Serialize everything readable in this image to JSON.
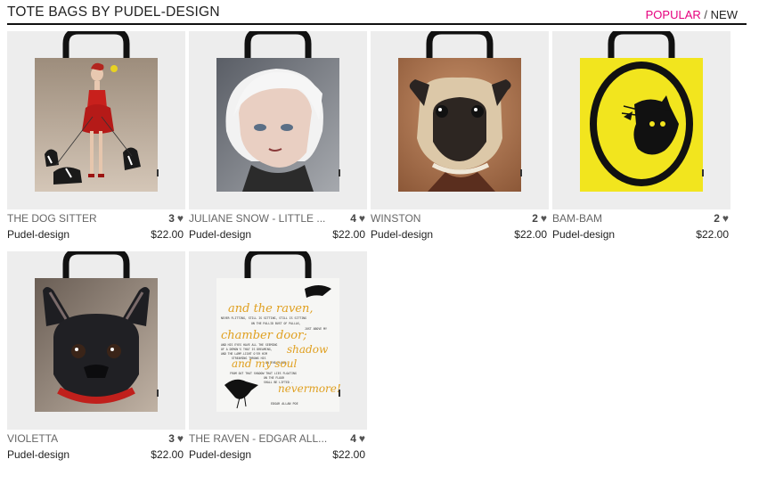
{
  "page": {
    "title": "TOTE BAGS BY PUDEL-DESIGN",
    "sort": {
      "popular": "POPULAR",
      "separator": "/",
      "new": "NEW",
      "active": "NEW"
    }
  },
  "colors": {
    "accent": "#e6007e",
    "thumb_bg": "#ededed"
  },
  "products": [
    {
      "name": "THE DOG SITTER",
      "likes": "3",
      "artist": "Pudel-design",
      "price": "$22.00",
      "art": "dog-sitter-painting"
    },
    {
      "name": "JULIANE SNOW - LITTLE ...",
      "likes": "4",
      "artist": "Pudel-design",
      "price": "$22.00",
      "art": "white-haired-girl-portrait"
    },
    {
      "name": "WINSTON",
      "likes": "2",
      "artist": "Pudel-design",
      "price": "$22.00",
      "art": "pug-portrait"
    },
    {
      "name": "BAM-BAM",
      "likes": "2",
      "artist": "Pudel-design",
      "price": "$22.00",
      "art": "cat-silhouette-cameo"
    },
    {
      "name": "VIOLETTA",
      "likes": "3",
      "artist": "Pudel-design",
      "price": "$22.00",
      "art": "french-bulldog-portrait"
    },
    {
      "name": "THE RAVEN - EDGAR ALL...",
      "likes": "4",
      "artist": "Pudel-design",
      "price": "$22.00",
      "art": "raven-poem-typography",
      "poem": {
        "line1": "and the raven,",
        "small1": "NEVER FLITTING, STILL IS SITTING, STILL IS SITTING",
        "small2": "ON THE PALLID BUST OF PALLAS,",
        "small3": "JUST ABOVE MY",
        "line2": "chamber door;",
        "small4": "AND HIS EYES HAVE ALL THE SEEMING",
        "small5": "OF A DEMON'S THAT IS DREAMING,",
        "small6": "AND THE LAMP-LIGHT O'ER HIM",
        "small7": "STREAMING THROWS HIS",
        "line3": "shadow",
        "small8": "ON THE FLOOR;",
        "line4": "and my soul",
        "small9": "FROM OUT THAT SHADOW THAT LIES FLOATING",
        "small10": "ON THE FLOOR",
        "small11": "SHALL BE LIFTED -",
        "line5": "nevermore!",
        "author": "EDGAR ALLAN POE"
      }
    }
  ]
}
